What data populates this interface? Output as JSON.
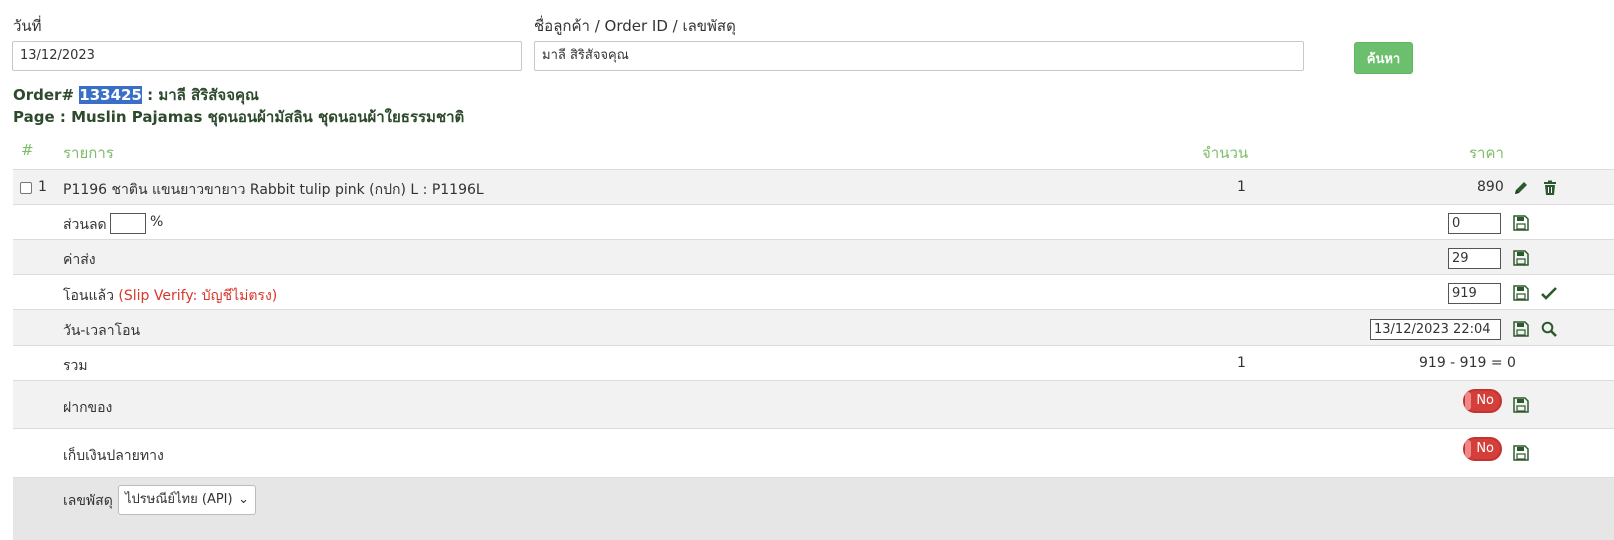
{
  "search": {
    "date_label": "วันที่",
    "date_value": "13/12/2023",
    "customer_label": "ชื่อลูกค้า / Order ID / เลขพัสดุ",
    "customer_value": "มาลี สิริสัจจคุณ",
    "search_button": "ค้นหา"
  },
  "order": {
    "prefix": "Order#",
    "id": "133425",
    "customer_suffix": " : มาลี สิริสัจจคุณ",
    "page_line": "Page : Muslin Pajamas ชุดนอนผ้ามัสลิน ชุดนอนผ้าใยธรรมชาติ"
  },
  "table": {
    "headers": {
      "index": "#",
      "item": "รายการ",
      "qty": "จำนวน",
      "price": "ราคา"
    },
    "item_row": {
      "index": "1",
      "name": "P1196 ชาติน แขนยาวขายาว Rabbit tulip pink (กปก) L : P1196L",
      "qty": "1",
      "price": "890"
    },
    "discount": {
      "label": "ส่วนลด",
      "unit": "%",
      "percent_value": "",
      "amount_value": "0"
    },
    "shipping": {
      "label": "ค่าส่ง",
      "value": "29"
    },
    "transferred": {
      "label": "โอนแล้ว",
      "note": "(Slip Verify: บัญชีไม่ตรง)",
      "value": "919"
    },
    "transfer_time": {
      "label": "วัน-เวลาโอน",
      "value": "13/12/2023 22:04"
    },
    "total": {
      "label": "รวม",
      "qty": "1",
      "formula": "919 - 919 = 0"
    },
    "deposit": {
      "label": "ฝากของ",
      "toggle": "No"
    },
    "cod": {
      "label": "เก็บเงินปลายทาง",
      "toggle": "No"
    },
    "tracking": {
      "label": "เลขพัสดุ",
      "carrier_selected": "ไปรษณีย์ไทย (API)"
    }
  },
  "colors": {
    "accent_green": "#7dbd6a",
    "button_green": "#6cbf6c",
    "alert_red": "#d9362b",
    "toggle_red": "#d43f3a"
  }
}
